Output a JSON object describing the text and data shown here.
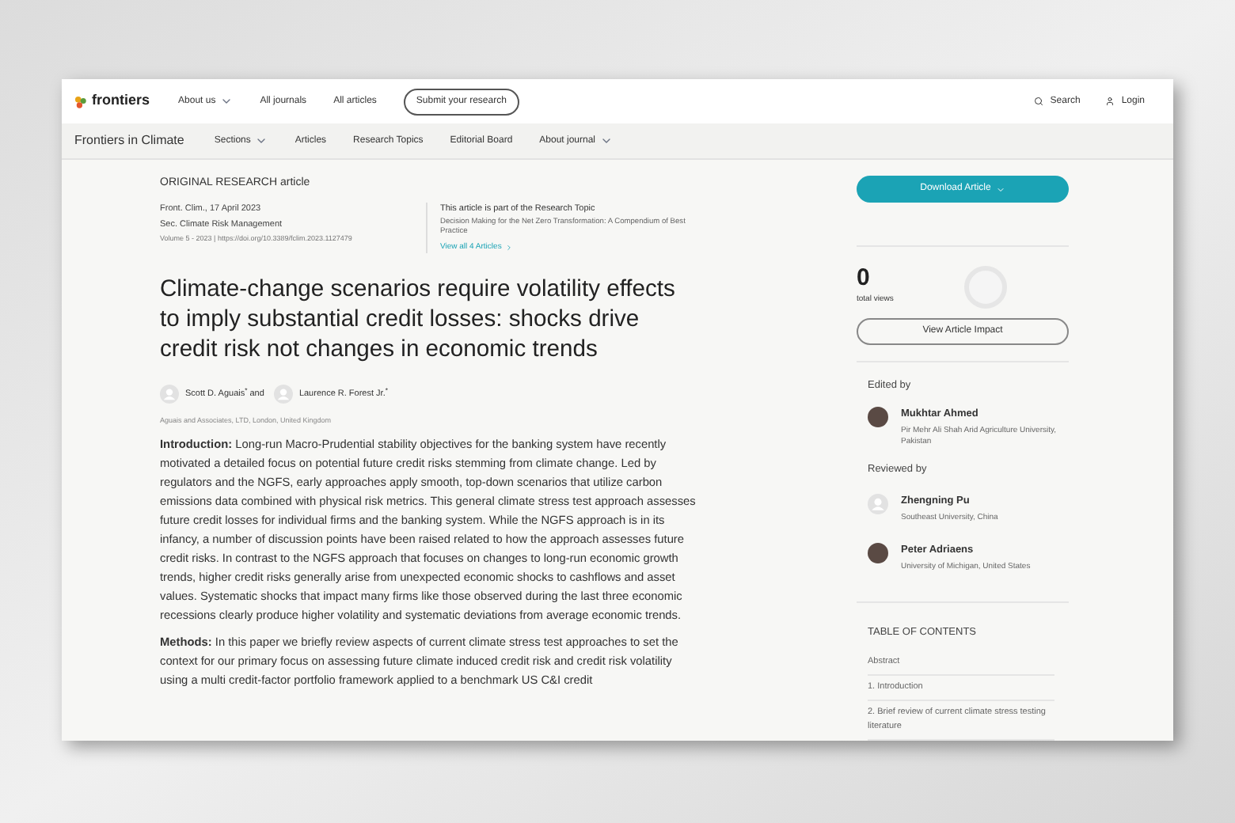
{
  "topbar": {
    "logo": "frontiers",
    "links": [
      {
        "label": "About us",
        "dropdown": true
      },
      {
        "label": "All journals",
        "dropdown": false
      },
      {
        "label": "All articles",
        "dropdown": false
      }
    ],
    "submit": "Submit your research",
    "search": "Search",
    "login": "Login"
  },
  "journal_nav": {
    "title": "Frontiers in Climate",
    "items": [
      {
        "label": "Sections",
        "dropdown": true
      },
      {
        "label": "Articles",
        "dropdown": false
      },
      {
        "label": "Research Topics",
        "dropdown": false
      },
      {
        "label": "Editorial Board",
        "dropdown": false
      },
      {
        "label": "About journal",
        "dropdown": true
      }
    ]
  },
  "article": {
    "type": "ORIGINAL RESEARCH article",
    "date": "Front. Clim., 17 April 2023",
    "section": "Sec. Climate Risk Management",
    "volume": "Volume 5 - 2023 | https://doi.org/10.3389/fclim.2023.1127479",
    "topic_heading": "This article is part of the Research Topic",
    "topic": "Decision Making for the Net Zero Transformation: A Compendium of Best Practice",
    "topic_link": "View all 4 Articles",
    "title": "Climate-change scenarios require volatility effects to imply substantial credit losses: shocks drive credit risk not changes in economic trends",
    "authors": [
      {
        "name": "Scott D. Aguais",
        "mark": "*",
        "conj": "and"
      },
      {
        "name": "Laurence R. Forest Jr.",
        "mark": "*"
      }
    ],
    "affiliation": "Aguais and Associates, LTD, London, United Kingdom",
    "abstract": [
      "**Introduction:** Long-run Macro-Prudential stability objectives for the banking system have recently motivated a detailed focus on potential future credit risks stemming from climate change. Led by regulators and the NGFS, early approaches apply smooth, top-down scenarios that utilize carbon emissions data combined with physical risk metrics. This general climate stress test approach assesses future credit losses for individual firms and the banking system. While the NGFS approach is in its infancy, a number of discussion points have been raised related to how the approach assesses future credit risks. In contrast to the NGFS approach that focuses on changes to long-run economic growth trends, higher credit risks generally arise from unexpected economic shocks to cashflows and asset values. Systematic shocks that impact many firms like those observed during the last three economic recessions clearly produce higher volatility and systematic deviations from average economic trends.",
      "**Methods:** In this paper we briefly review aspects of current climate stress test approaches to set the context for our primary focus on assessing future climate induced credit risk and credit risk volatility using a multi credit-factor portfolio framework applied to a benchmark US C&I credit"
    ]
  },
  "sidebar": {
    "download": "Download Article",
    "views": "0",
    "views_label": "total views",
    "impact": "View Article Impact",
    "edited_heading": "Edited by",
    "editors": [
      {
        "name": "Mukhtar Ahmed",
        "affiliation": "Pir Mehr Ali Shah Arid Agriculture University, Pakistan",
        "kind": "photo"
      }
    ],
    "reviewed_heading": "Reviewed by",
    "reviewers": [
      {
        "name": "Zhengning Pu",
        "affiliation": "Southeast University, China",
        "kind": "placeholder"
      },
      {
        "name": "Peter Adriaens",
        "affiliation": "University of Michigan, United States",
        "kind": "photo"
      }
    ],
    "toc_heading": "TABLE OF CONTENTS",
    "toc": [
      "Abstract",
      "1. Introduction",
      "2. Brief review of current climate stress testing literature"
    ]
  }
}
